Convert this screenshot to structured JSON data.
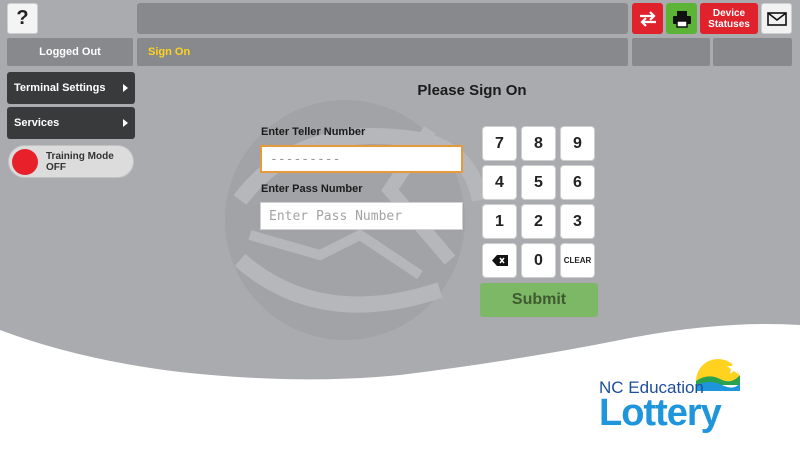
{
  "header": {
    "help_label": "?",
    "transfer_icon": "transfer-arrows-icon",
    "print_icon": "printer-icon",
    "device_statuses_label": "Device Statuses",
    "mail_icon": "envelope-icon"
  },
  "status_bar": {
    "login_state": "Logged Out",
    "message": "Sign On"
  },
  "sidebar": {
    "items": [
      {
        "label": "Terminal Settings"
      },
      {
        "label": "Services"
      }
    ],
    "training_mode_label": "Training Mode OFF"
  },
  "form": {
    "title": "Please Sign On",
    "teller_label": "Enter Teller Number",
    "teller_value": "---------",
    "pass_label": "Enter Pass Number",
    "pass_placeholder": "Enter Pass Number"
  },
  "keypad": {
    "keys": [
      "7",
      "8",
      "9",
      "4",
      "5",
      "6",
      "1",
      "2",
      "3",
      "",
      "0",
      "CLEAR"
    ],
    "backspace_icon": "backspace-icon",
    "submit_label": "Submit"
  },
  "logo": {
    "line1": "NC Education",
    "line2": "Lottery"
  },
  "colors": {
    "accent_red": "#e0222d",
    "accent_green": "#5cb436",
    "message_yellow": "#ffd21f",
    "submit_green": "#7db866"
  }
}
